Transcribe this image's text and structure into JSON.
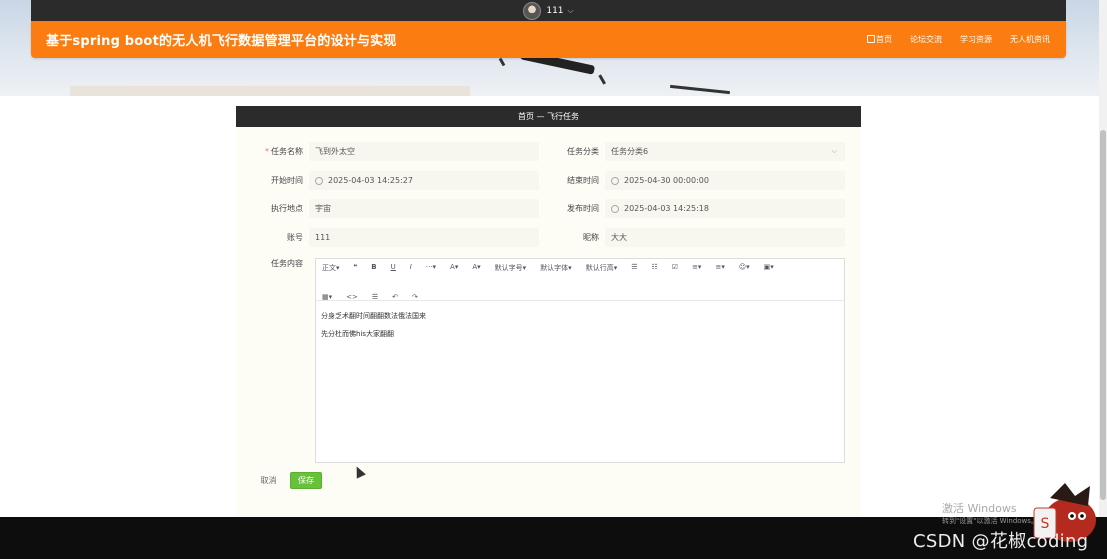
{
  "top_bar": {
    "username": "111"
  },
  "header": {
    "site_title": "基于spring boot的无人机飞行数据管理平台的设计与实现",
    "nav": [
      "首页",
      "论坛交流",
      "学习资源",
      "无人机资讯"
    ]
  },
  "card": {
    "breadcrumb": "首页 — 飞行任务"
  },
  "form": {
    "task_name": {
      "label": "任务名称",
      "value": "飞到外太空"
    },
    "task_category": {
      "label": "任务分类",
      "value": "任务分类6"
    },
    "start_time": {
      "label": "开始时间",
      "value": "2025-04-03 14:25:27"
    },
    "end_time": {
      "label": "结束时间",
      "value": "2025-04-30 00:00:00"
    },
    "location": {
      "label": "执行地点",
      "value": "宇宙"
    },
    "publish_time": {
      "label": "发布时间",
      "value": "2025-04-03 14:25:18"
    },
    "account": {
      "label": "账号",
      "value": "111"
    },
    "nickname": {
      "label": "昵称",
      "value": "大大"
    },
    "content": {
      "label": "任务内容",
      "toolbar_row1": [
        "正文▾",
        "❝",
        "B",
        "U",
        "I",
        "···▾",
        "A▾",
        "A▾",
        "默认字号▾",
        "默认字体▾",
        "默认行高▾",
        "☰",
        "☷",
        "☑",
        "≡▾",
        "≡▾",
        "☺▾",
        "▣▾"
      ],
      "toolbar_row2": [
        "▦▾",
        "<>",
        "☰",
        "↶",
        "↷"
      ],
      "lines": [
        "分身乏术翻时间翻翻数法俄法国来",
        "先分杜而佛his大家翻翻"
      ]
    }
  },
  "buttons": {
    "cancel": "取消",
    "save": "保存"
  },
  "overlay": {
    "activate_title": "激活 Windows",
    "activate_sub": "转到\"设置\"以激活 Windows。",
    "watermark": "CSDN @花椒coding"
  }
}
